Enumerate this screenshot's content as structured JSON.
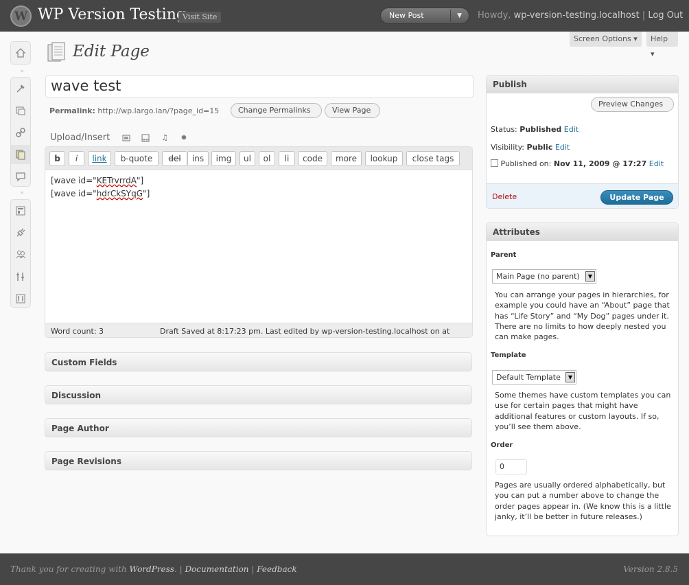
{
  "header": {
    "logo_letter": "W",
    "site_title": "WP Version Testing",
    "visit_site": "Visit Site",
    "new_post": "New Post",
    "howdy": "Howdy, ",
    "user": "wp-version-testing.localhost",
    "separator": " | ",
    "logout": "Log Out"
  },
  "screen_meta": {
    "screen_options": "Screen Options ▾",
    "help": "Help ▾"
  },
  "menu": {
    "icons": [
      "dashboard-icon",
      "posts-icon",
      "media-icon",
      "links-icon",
      "pages-icon",
      "comments-icon",
      "appearance-icon",
      "plugins-icon",
      "users-icon",
      "tools-icon",
      "settings-icon"
    ],
    "active": "pages-icon"
  },
  "page": {
    "heading": "Edit Page",
    "title_value": "wave test",
    "permalink_label": "Permalink:",
    "permalink_url": "http://wp.largo.lan/?page_id=15",
    "change_permalinks": "Change Permalinks",
    "view_page": "View Page",
    "upload_insert": "Upload/Insert"
  },
  "editor": {
    "buttons": [
      "b",
      "i",
      "link",
      "b-quote",
      "del",
      "ins",
      "img",
      "ul",
      "ol",
      "li",
      "code",
      "more",
      "lookup",
      "close tags"
    ],
    "line1_prefix": "[wave id=\"",
    "line1_id": "KETrvrrdA",
    "line1_suffix": "\"]",
    "line2_prefix": "[wave id=\"",
    "line2_id": "hdrCkSYqG",
    "line2_suffix": "\"]",
    "word_count": "Word count: 3",
    "draft_saved": "Draft Saved at 8:17:23 pm. Last edited by wp-version-testing.localhost on at"
  },
  "boxes": {
    "custom_fields": "Custom Fields",
    "discussion": "Discussion",
    "page_author": "Page Author",
    "page_revisions": "Page Revisions"
  },
  "publish": {
    "title": "Publish",
    "preview": "Preview Changes",
    "status_label": "Status:",
    "status_value": "Published",
    "visibility_label": "Visibility:",
    "visibility_value": "Public",
    "published_on_label": "Published on:",
    "published_on_value": "Nov 11, 2009 @ 17:27",
    "edit": "Edit",
    "delete": "Delete",
    "update": "Update Page"
  },
  "attributes": {
    "title": "Attributes",
    "parent_label": "Parent",
    "parent_value": "Main Page (no parent)",
    "parent_help": "You can arrange your pages in hierarchies, for example you could have an “About” page that has “Life Story” and “My Dog” pages under it. There are no limits to how deeply nested you can make pages.",
    "template_label": "Template",
    "template_value": "Default Template",
    "template_help": "Some themes have custom templates you can use for certain pages that might have additional features or custom layouts. If so, you’ll see them above.",
    "order_label": "Order",
    "order_value": "0",
    "order_help": "Pages are usually ordered alphabetically, but you can put a number above to change the order pages appear in. (We know this is a little janky, it’ll be better in future releases.)"
  },
  "footer": {
    "thanks": "Thank you for creating with ",
    "wordpress": "WordPress",
    "documentation": "Documentation",
    "feedback": "Feedback",
    "version": "Version 2.8.5"
  }
}
